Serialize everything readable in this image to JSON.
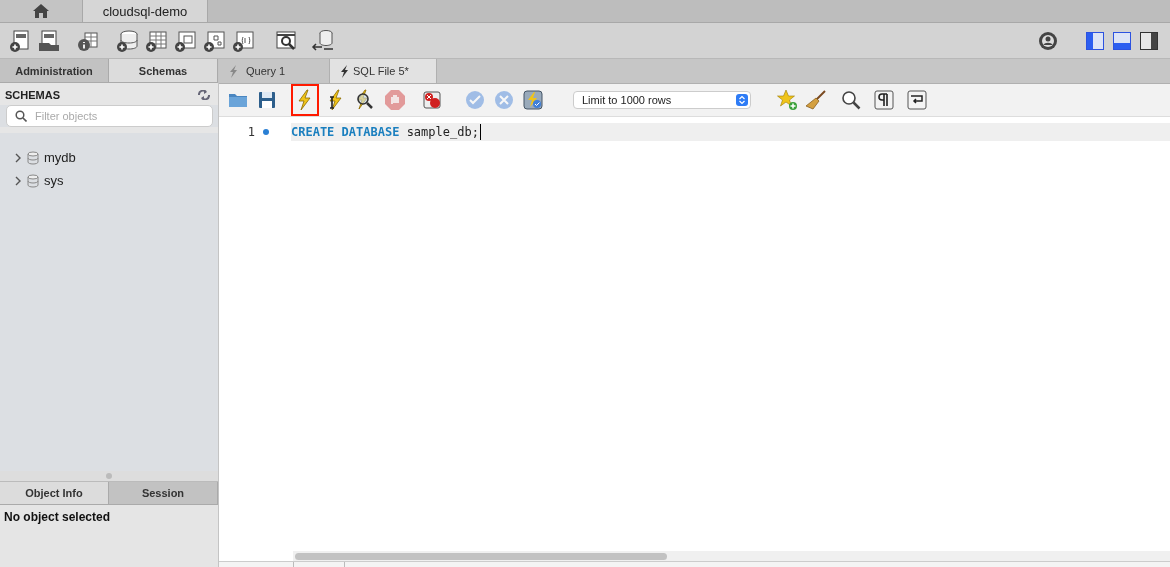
{
  "window_tabs": [
    {
      "kind": "home",
      "selected": false
    },
    {
      "label": "cloudsql-demo",
      "selected": true
    }
  ],
  "main_toolbar": [
    {
      "kind": "sql-doc-plus"
    },
    {
      "kind": "sql-doc-open"
    },
    {
      "kind": "info-table"
    },
    {
      "kind": "db-plus"
    },
    {
      "kind": "table-plus"
    },
    {
      "kind": "view-plus"
    },
    {
      "kind": "proc-plus"
    },
    {
      "kind": "func-plus"
    },
    {
      "kind": "doc-search"
    },
    {
      "kind": "db-reconnect"
    }
  ],
  "right_toolbar": [
    {
      "kind": "gear",
      "on": false
    },
    {
      "kind": "panel-left",
      "on": true
    },
    {
      "kind": "panel-bottom",
      "on": true
    },
    {
      "kind": "panel-right",
      "on": false
    }
  ],
  "sidebar": {
    "tabs": [
      {
        "label": "Administration",
        "selected": false
      },
      {
        "label": "Schemas",
        "selected": true
      }
    ],
    "header": "SCHEMAS",
    "search": {
      "placeholder": "Filter objects"
    },
    "schemas": [
      {
        "name": "mydb",
        "expanded": false
      },
      {
        "name": "sys",
        "expanded": false
      }
    ],
    "info_tabs": [
      {
        "label": "Object Info",
        "selected": true
      },
      {
        "label": "Session",
        "selected": false
      }
    ],
    "info_text": "No object selected"
  },
  "editor_tabs": [
    {
      "label": "Query 1",
      "selected": false
    },
    {
      "label": "SQL File 5*",
      "selected": true
    }
  ],
  "editor_toolbar": [
    {
      "kind": "folder",
      "disabled": false,
      "highlighted": false
    },
    {
      "kind": "floppy",
      "disabled": false,
      "highlighted": false
    },
    {
      "kind": "bolt",
      "disabled": false,
      "highlighted": true
    },
    {
      "kind": "bolt-cursor",
      "disabled": false,
      "highlighted": false
    },
    {
      "kind": "bolt-search",
      "disabled": false,
      "highlighted": false
    },
    {
      "kind": "stop-hand",
      "disabled": true,
      "highlighted": false
    },
    {
      "kind": "clear-output",
      "disabled": false,
      "highlighted": false
    },
    {
      "kind": "check-circle",
      "disabled": true,
      "highlighted": false
    },
    {
      "kind": "x-circle",
      "disabled": true,
      "highlighted": false
    },
    {
      "kind": "autocommit",
      "disabled": false,
      "highlighted": false
    },
    {
      "kind": "select",
      "label": "Limit to 1000 rows",
      "disabled": false,
      "highlighted": false
    },
    {
      "kind": "star-plus",
      "disabled": false,
      "highlighted": false
    },
    {
      "kind": "broom",
      "disabled": false,
      "highlighted": false
    },
    {
      "kind": "magnifier",
      "disabled": false,
      "highlighted": false
    },
    {
      "kind": "pilcrow",
      "disabled": false,
      "highlighted": false
    },
    {
      "kind": "wrap",
      "disabled": false,
      "highlighted": false
    }
  ],
  "editor": {
    "lines": [
      {
        "number": "1",
        "tokens": [
          {
            "text": "CREATE",
            "kind": "keyword"
          },
          {
            "text": "DATABASE",
            "kind": "keyword"
          },
          {
            "text": "sample_db;",
            "kind": "identifier"
          }
        ]
      }
    ]
  }
}
